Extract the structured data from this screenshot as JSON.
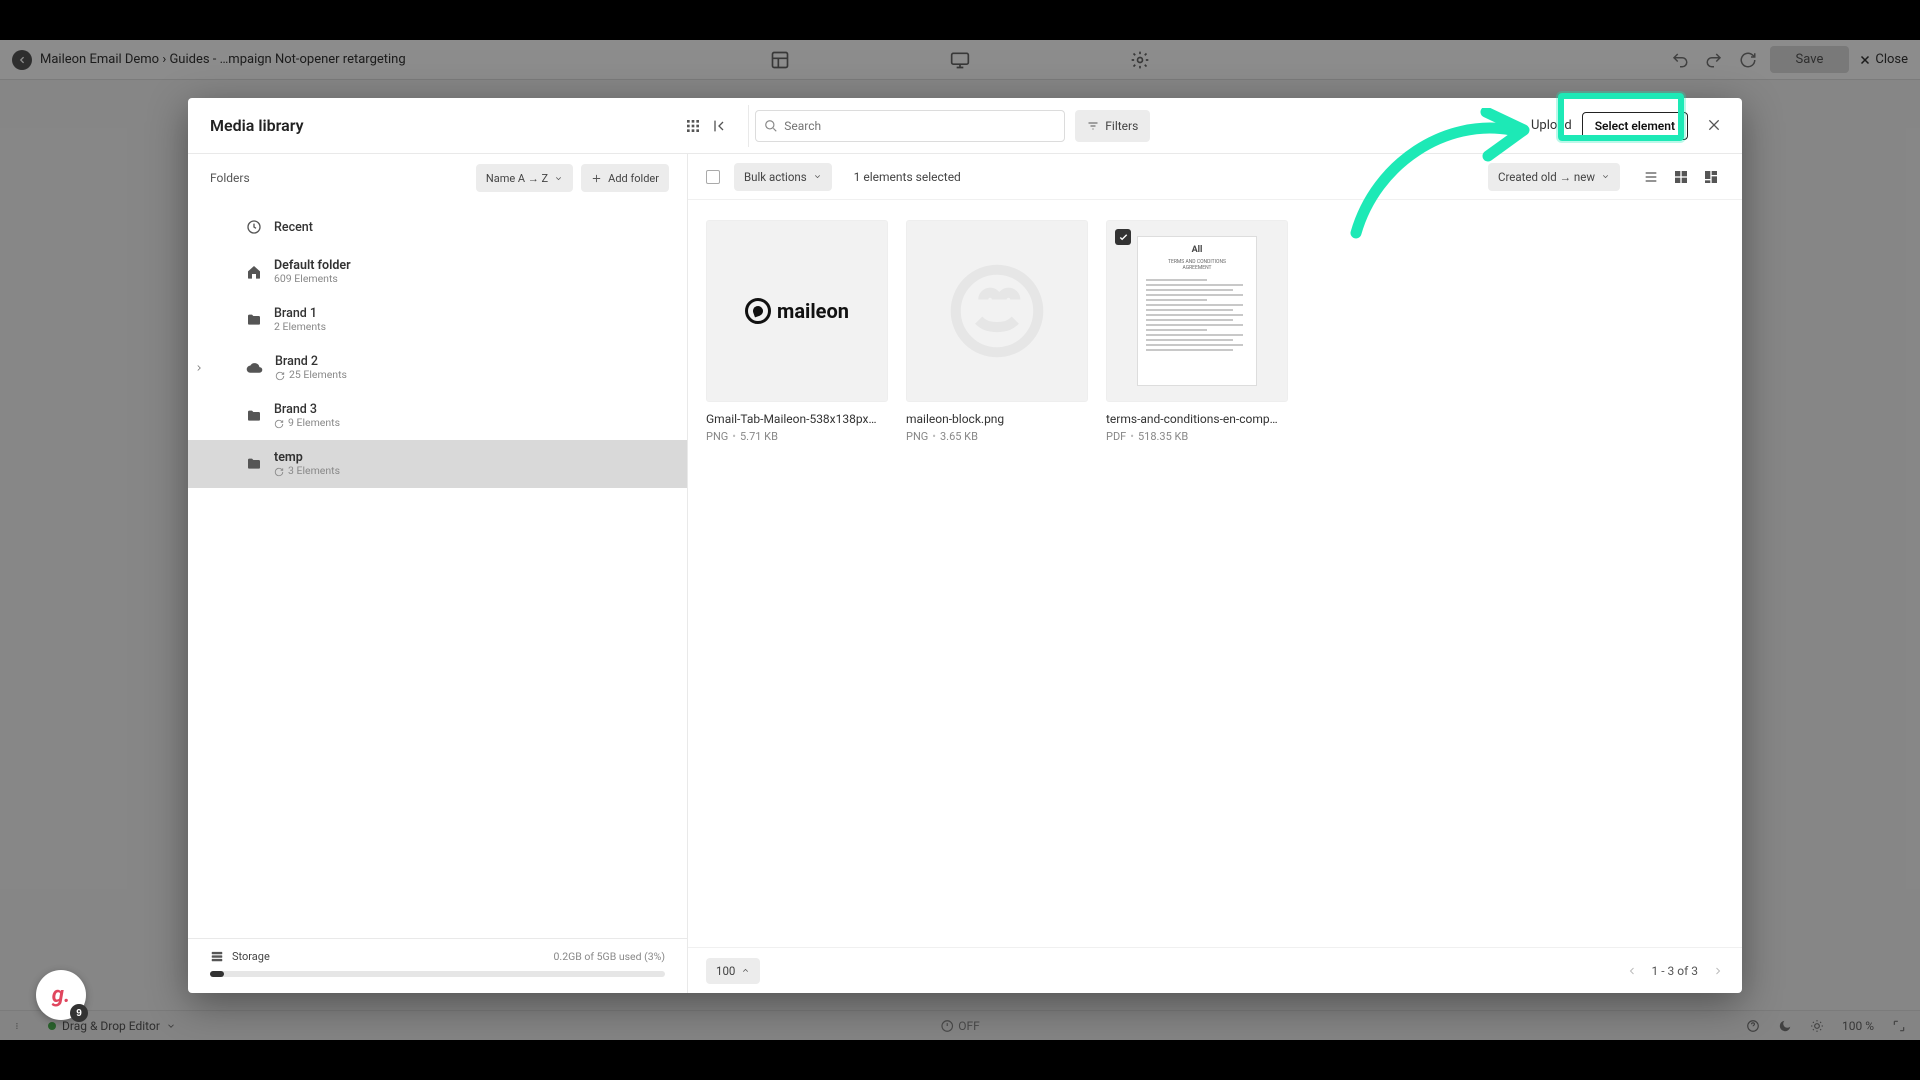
{
  "colors": {
    "accent": "#1de9b6"
  },
  "bg_topbar": {
    "title": "Maileon Email Demo › Guides - …mpaign Not-opener retargeting",
    "save": "Save",
    "close": "Close"
  },
  "bg_bottombar": {
    "editor": "Drag & Drop Editor",
    "center": "OFF",
    "zoom": "100 %"
  },
  "modal": {
    "title": "Media library",
    "search_placeholder": "Search",
    "filters": "Filters",
    "upload": "Upload",
    "select_element": "Select element"
  },
  "sidebar": {
    "folders_label": "Folders",
    "sort_label": "Name A → Z",
    "add_folder": "Add folder",
    "recent": "Recent",
    "items": [
      {
        "name": "Default folder",
        "meta": "609 Elements",
        "icon": "home",
        "bold": true
      },
      {
        "name": "Brand 1",
        "meta": "2 Elements",
        "icon": "folder"
      },
      {
        "name": "Brand 2",
        "meta": "25 Elements",
        "icon": "cloud",
        "expandable": true
      },
      {
        "name": "Brand 3",
        "meta": "9 Elements",
        "icon": "folder"
      },
      {
        "name": "temp",
        "meta": "3 Elements",
        "icon": "folder",
        "selected": true,
        "bold": true
      }
    ],
    "storage": {
      "label": "Storage",
      "value": "0.2GB of 5GB used (3%)",
      "percent": 3
    }
  },
  "toolbar": {
    "bulk": "Bulk actions",
    "selected": "1 elements selected",
    "sort": "Created old → new"
  },
  "files": [
    {
      "name": "Gmail-Tab-Maileon-538x138px…",
      "type": "PNG",
      "size": "5.71 KB",
      "thumb": "maileon-logo",
      "selected": false
    },
    {
      "name": "maileon-block.png",
      "type": "PNG",
      "size": "3.65 KB",
      "thumb": "block-icon",
      "selected": false
    },
    {
      "name": "terms-and-conditions-en-comp…",
      "type": "PDF",
      "size": "518.35 KB",
      "thumb": "document",
      "selected": true,
      "doc_title": "All"
    }
  ],
  "footer": {
    "page_size": "100",
    "range": "1 - 3  of  3"
  },
  "g_badge": {
    "letter": "g.",
    "count": "9"
  }
}
